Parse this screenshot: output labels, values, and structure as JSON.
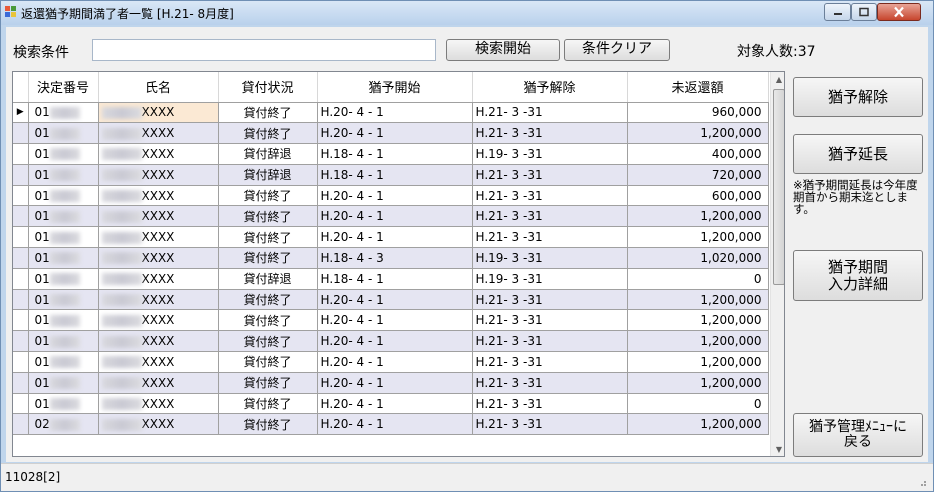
{
  "window": {
    "title": "返還猶予期間満了者一覧 [H.21- 8月度]"
  },
  "search": {
    "label": "検索条件",
    "value": "",
    "start_label": "検索開始",
    "clear_label": "条件クリア"
  },
  "count_label": "対象人数:37",
  "grid": {
    "headers": [
      "決定番号",
      "氏名",
      "貸付状況",
      "猶予開始",
      "猶予解除",
      "未返還額"
    ],
    "rows": [
      {
        "num": "01",
        "name": "XXXX",
        "status": "貸付終了",
        "start": "H.20- 4 - 1",
        "end": "H.21- 3 -31",
        "amount": "960,000"
      },
      {
        "num": "01",
        "name": "XXXX",
        "status": "貸付終了",
        "start": "H.20- 4 - 1",
        "end": "H.21- 3 -31",
        "amount": "1,200,000"
      },
      {
        "num": "01",
        "name": "XXXX",
        "status": "貸付辞退",
        "start": "H.18- 4 - 1",
        "end": "H.19- 3 -31",
        "amount": "400,000"
      },
      {
        "num": "01",
        "name": "XXXX",
        "status": "貸付辞退",
        "start": "H.18- 4 - 1",
        "end": "H.21- 3 -31",
        "amount": "720,000"
      },
      {
        "num": "01",
        "name": "XXXX",
        "status": "貸付終了",
        "start": "H.20- 4 - 1",
        "end": "H.21- 3 -31",
        "amount": "600,000"
      },
      {
        "num": "01",
        "name": "XXXX",
        "status": "貸付終了",
        "start": "H.20- 4 - 1",
        "end": "H.21- 3 -31",
        "amount": "1,200,000"
      },
      {
        "num": "01",
        "name": "XXXX",
        "status": "貸付終了",
        "start": "H.20- 4 - 1",
        "end": "H.21- 3 -31",
        "amount": "1,200,000"
      },
      {
        "num": "01",
        "name": "XXXX",
        "status": "貸付終了",
        "start": "H.18- 4 - 3",
        "end": "H.19- 3 -31",
        "amount": "1,020,000"
      },
      {
        "num": "01",
        "name": "XXXX",
        "status": "貸付辞退",
        "start": "H.18- 4 - 1",
        "end": "H.19- 3 -31",
        "amount": "0"
      },
      {
        "num": "01",
        "name": "XXXX",
        "status": "貸付終了",
        "start": "H.20- 4 - 1",
        "end": "H.21- 3 -31",
        "amount": "1,200,000"
      },
      {
        "num": "01",
        "name": "XXXX",
        "status": "貸付終了",
        "start": "H.20- 4 - 1",
        "end": "H.21- 3 -31",
        "amount": "1,200,000"
      },
      {
        "num": "01",
        "name": "XXXX",
        "status": "貸付終了",
        "start": "H.20- 4 - 1",
        "end": "H.21- 3 -31",
        "amount": "1,200,000"
      },
      {
        "num": "01",
        "name": "XXXX",
        "status": "貸付終了",
        "start": "H.20- 4 - 1",
        "end": "H.21- 3 -31",
        "amount": "1,200,000"
      },
      {
        "num": "01",
        "name": "XXXX",
        "status": "貸付終了",
        "start": "H.20- 4 - 1",
        "end": "H.21- 3 -31",
        "amount": "1,200,000"
      },
      {
        "num": "01",
        "name": "XXXX",
        "status": "貸付終了",
        "start": "H.20- 4 - 1",
        "end": "H.21- 3 -31",
        "amount": "0"
      },
      {
        "num": "02",
        "name": "XXXX",
        "status": "貸付終了",
        "start": "H.20- 4 - 1",
        "end": "H.21- 3 -31",
        "amount": "1,200,000"
      }
    ]
  },
  "side": {
    "release_label": "猶予解除",
    "extend_label": "猶予延長",
    "note": "※猶予期間延長は今年度期首から期末迄とします。",
    "detail_label": "猶予期間\n入力詳細",
    "back_label": "猶予管理ﾒﾆｭｰに\n戻る"
  },
  "status": {
    "text": "11028[2]"
  },
  "colors": {
    "title_gradient": "#c8dcf2",
    "alt_row": "#e5e5f2",
    "selected_cell": "#fbe9d4"
  },
  "icons": [
    "app-icon",
    "minimize-icon",
    "maximize-icon",
    "close-icon",
    "row-pointer-icon",
    "scroll-up-icon",
    "scroll-down-icon",
    "resize-grip-icon"
  ]
}
